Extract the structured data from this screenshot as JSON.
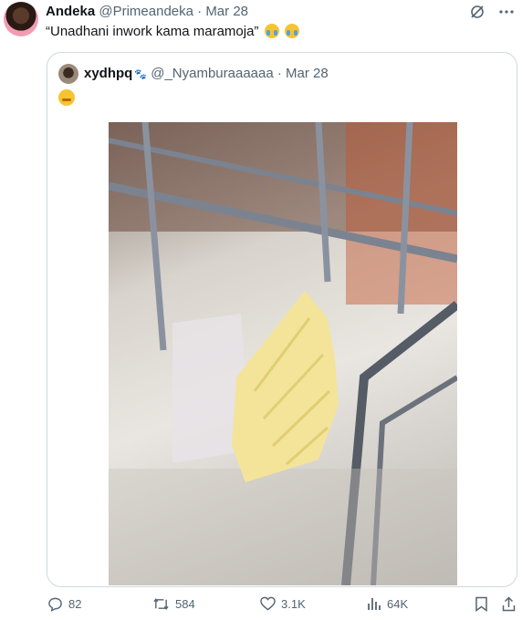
{
  "tweet": {
    "author_name": "Andeka",
    "author_handle": "@Primeandeka",
    "separator": "·",
    "date": "Mar 28",
    "text": "“Unadhani inwork kama maramoja”",
    "emojis": [
      "loudly-crying-face",
      "loudly-crying-face"
    ]
  },
  "quoted": {
    "author_name": "xydhpq",
    "author_handle": "@_Nyamburaaaaaa",
    "separator": "·",
    "date": "Mar 28",
    "emoji": "relieved-face",
    "media": "photo of a yellow fruit slice in plastic wrap held over a balcony railing"
  },
  "actions": {
    "replies": "82",
    "reposts": "584",
    "likes": "3.1K",
    "views": "64K"
  },
  "colors": {
    "text": "#0f1419",
    "muted": "#536471",
    "border": "#cfd9de"
  }
}
